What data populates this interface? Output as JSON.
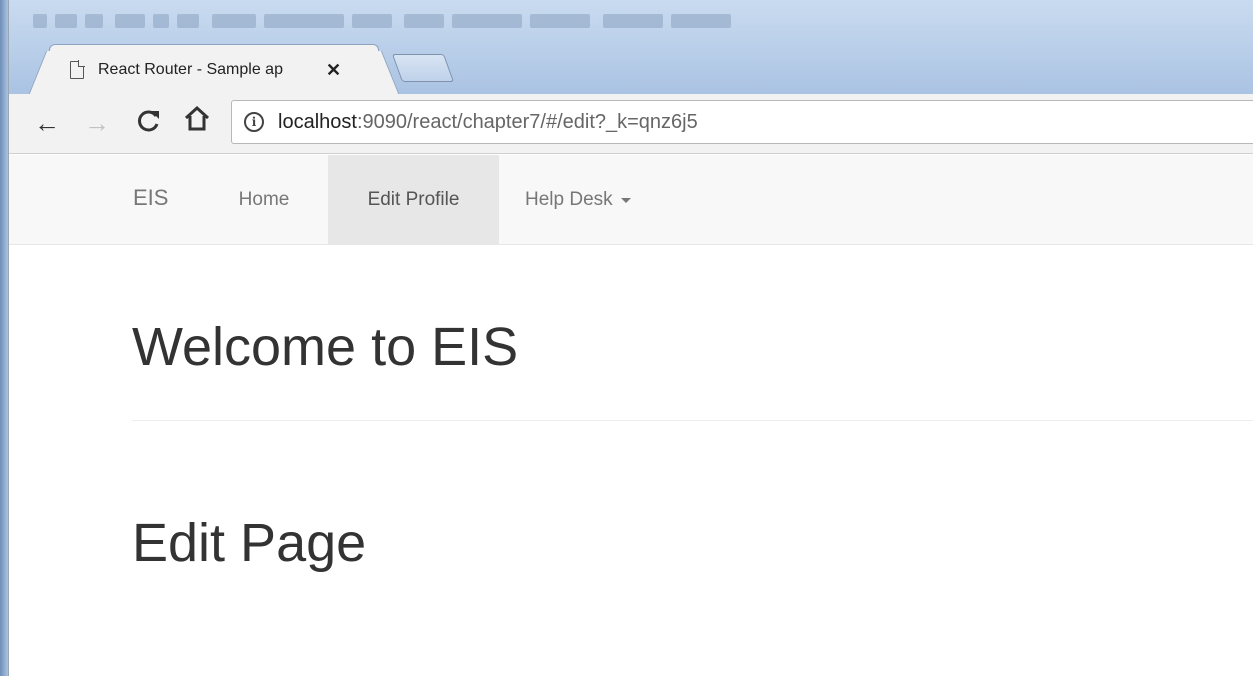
{
  "browser": {
    "tab_title": "React Router - Sample ap",
    "tab_close": "✕",
    "back": "←",
    "forward": "→",
    "reload": "C",
    "home": "⌂",
    "info_icon": "i",
    "url_host": "localhost",
    "url_rest": ":9090/react/chapter7/#/edit?_k=qnz6j5"
  },
  "navbar": {
    "brand": "EIS",
    "items": [
      {
        "label": "Home"
      },
      {
        "label": "Edit Profile",
        "active": true
      },
      {
        "label": "Help Desk"
      }
    ]
  },
  "main": {
    "welcome_heading": "Welcome to EIS",
    "page_heading": "Edit Page"
  },
  "colors": {
    "navbar_bg": "#f8f8f8",
    "active_item_bg": "#e7e7e7",
    "heading_text": "#333333"
  }
}
